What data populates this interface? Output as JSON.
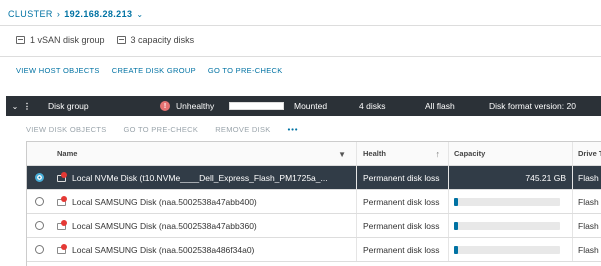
{
  "breadcrumb": {
    "parent": "CLUSTER",
    "separator": "›",
    "host": "192.168.28.213",
    "chevron": "⌄"
  },
  "summary": {
    "disk_groups": "1 vSAN disk group",
    "capacity_disks": "3 capacity disks"
  },
  "actions": [
    "VIEW HOST OBJECTS",
    "CREATE DISK GROUP",
    "GO TO PRE-CHECK"
  ],
  "disk_group": {
    "expander": "⌄",
    "menu": "⋮",
    "name": "Disk group",
    "status_icon": "!",
    "health": "Unhealthy",
    "state": "Mounted",
    "disks": "4 disks",
    "type": "All flash",
    "format": "Disk format version: 20"
  },
  "sub_actions": {
    "items": [
      "VIEW DISK OBJECTS",
      "GO TO PRE-CHECK",
      "REMOVE DISK"
    ],
    "more": "•••"
  },
  "table": {
    "headers": {
      "name": "Name",
      "health": "Health",
      "capacity": "Capacity",
      "type": "Drive Type"
    },
    "filter_icon": "▼",
    "sort_icon": "↑",
    "rows": [
      {
        "name": "Local NVMe Disk (t10.NVMe____Dell_Express_Flash_PM1725a_...",
        "health": "Permanent disk loss",
        "capacity": "745.21 GB",
        "type": "Flash",
        "selected": true,
        "usage": null
      },
      {
        "name": "Local SAMSUNG Disk (naa.5002538a47abb400)",
        "health": "Permanent disk loss",
        "capacity": "",
        "type": "Flash",
        "selected": false,
        "usage": 0.04
      },
      {
        "name": "Local SAMSUNG Disk (naa.5002538a47abb360)",
        "health": "Permanent disk loss",
        "capacity": "",
        "type": "Flash",
        "selected": false,
        "usage": 0.04
      },
      {
        "name": "Local SAMSUNG Disk (naa.5002538a486f34a0)",
        "health": "Permanent disk loss",
        "capacity": "",
        "type": "Flash",
        "selected": false,
        "usage": 0.04
      }
    ]
  },
  "colors": {
    "link": "#0072a3",
    "header_bg": "#2b3137",
    "selected_row": "#313c47",
    "error": "#e53935",
    "capacity_fill": "#0072a3"
  }
}
